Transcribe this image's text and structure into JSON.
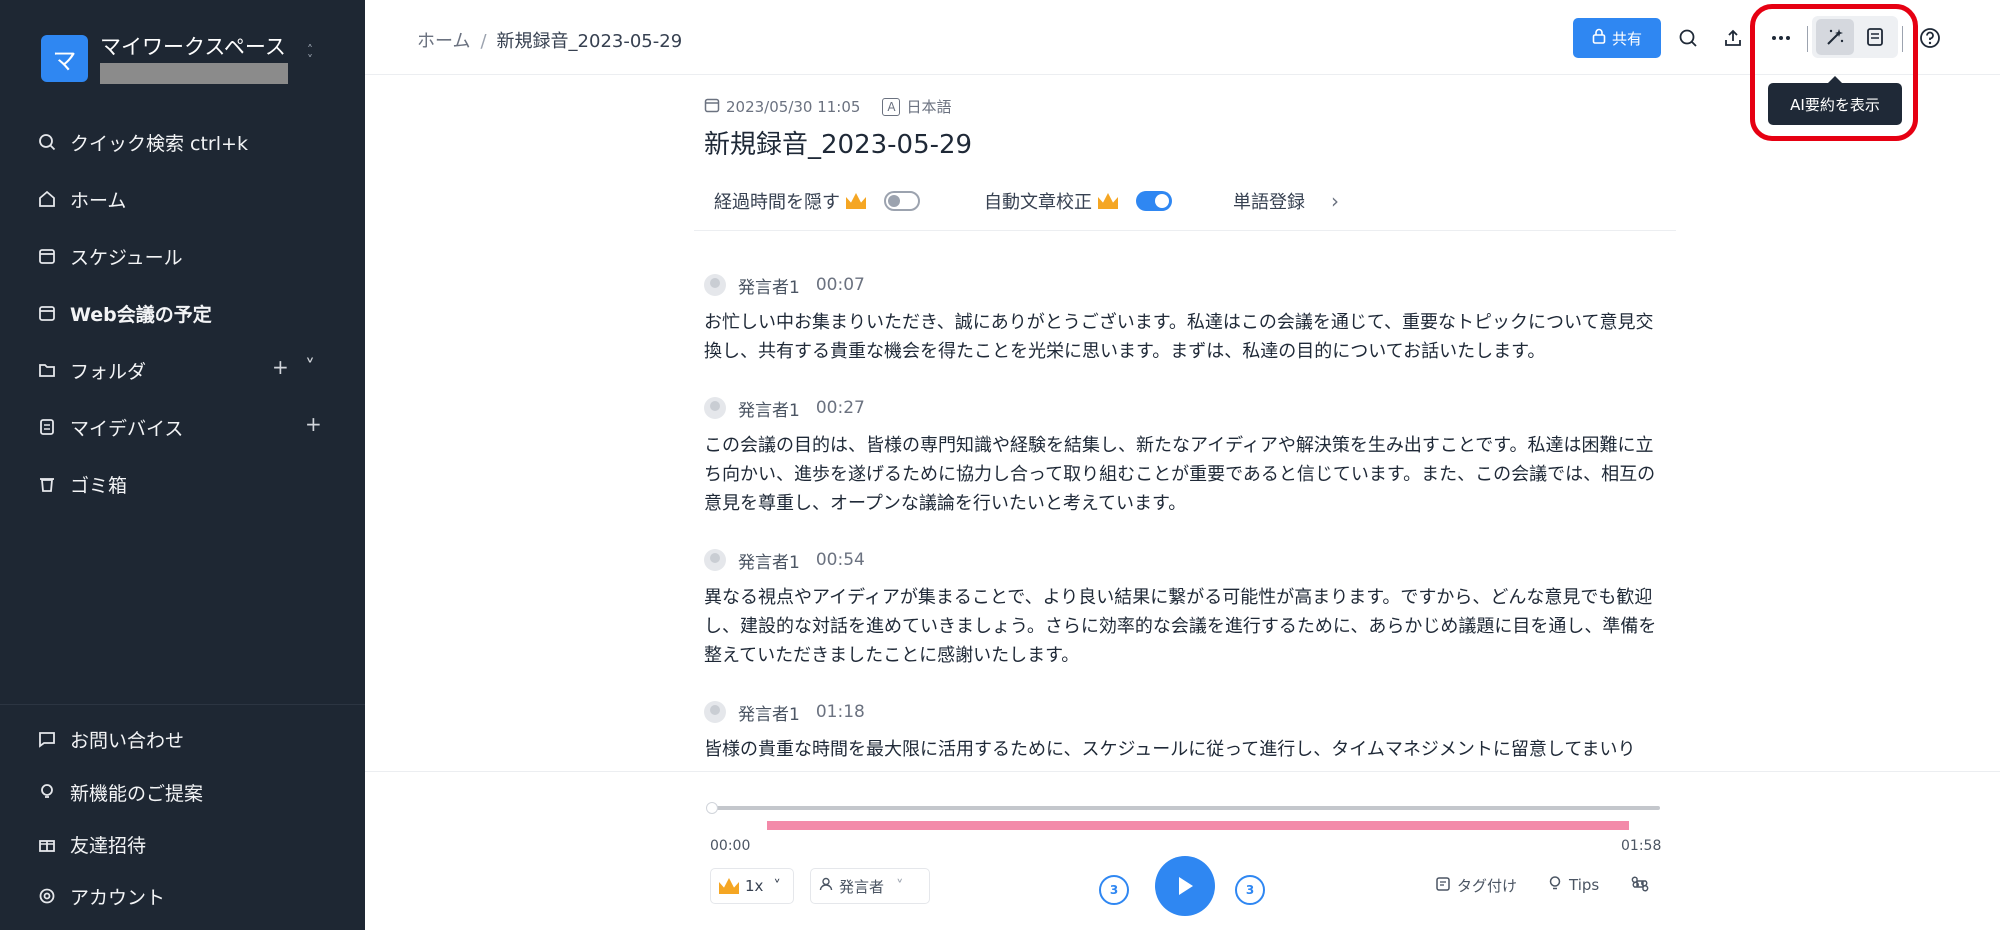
{
  "workspace": {
    "initial": "マ",
    "name": "マイワークスペース"
  },
  "sidebar": {
    "items": [
      {
        "label": "クイック検索 ctrl+k",
        "icon": "search-icon"
      },
      {
        "label": "ホーム",
        "icon": "home-icon"
      },
      {
        "label": "スケジュール",
        "icon": "calendar-icon"
      },
      {
        "label": "Web会議の予定",
        "icon": "calendar-icon"
      },
      {
        "label": "フォルダ",
        "icon": "folder-icon"
      },
      {
        "label": "マイデバイス",
        "icon": "device-icon"
      },
      {
        "label": "ゴミ箱",
        "icon": "trash-icon"
      }
    ],
    "bottom_items": [
      {
        "label": "お問い合わせ",
        "icon": "chat-icon"
      },
      {
        "label": "新機能のご提案",
        "icon": "lightbulb-icon"
      },
      {
        "label": "友達招待",
        "icon": "gift-icon"
      },
      {
        "label": "アカウント",
        "icon": "gear-icon"
      }
    ]
  },
  "header": {
    "breadcrumb_home": "ホーム",
    "breadcrumb_sep": "/",
    "breadcrumb_current": "新規録音_2023-05-29",
    "share_label": "共有",
    "tooltip": "AI要約を表示"
  },
  "recording": {
    "datetime": "2023/05/30 11:05",
    "language_icon": "A",
    "language": "日本語",
    "title": "新規録音_2023-05-29"
  },
  "options": {
    "hide_elapsed": "経過時間を隠す",
    "auto_correct": "自動文章校正",
    "word_register": "単語登録",
    "hide_elapsed_on": false,
    "auto_correct_on": true
  },
  "transcript": [
    {
      "speaker": "発言者1",
      "time": "00:07",
      "text": "お忙しい中お集まりいただき、誠にありがとうございます。私達はこの会議を通じて、重要なトピックについて意見交換し、共有する貴重な機会を得たことを光栄に思います。まずは、私達の目的についてお話いたします。"
    },
    {
      "speaker": "発言者1",
      "time": "00:27",
      "text": "この会議の目的は、皆様の専門知識や経験を結集し、新たなアイディアや解決策を生み出すことです。私達は困難に立ち向かい、進歩を遂げるために協力し合って取り組むことが重要であると信じています。また、この会議では、相互の意見を尊重し、オープンな議論を行いたいと考えています。"
    },
    {
      "speaker": "発言者1",
      "time": "00:54",
      "text": "異なる視点やアイディアが集まることで、より良い結果に繋がる可能性が高まります。ですから、どんな意見でも歓迎し、建設的な対話を進めていきましょう。さらに効率的な会議を進行するために、あらかじめ議題に目を通し、準備を整えていただきましたことに感謝いたします。"
    },
    {
      "speaker": "発言者1",
      "time": "01:18",
      "text": "皆様の貴重な時間を最大限に活用するために、スケジュールに従って進行し、タイムマネジメントに留意してまいり"
    }
  ],
  "player": {
    "time_start": "00:00",
    "time_end": "01:58",
    "position_fraction": 0,
    "speed": "1x",
    "speaker_filter": "発言者",
    "skip_back": "3",
    "skip_forward": "3",
    "tag_label": "タグ付け",
    "tips_label": "Tips"
  },
  "colors": {
    "accent": "#2f87f2",
    "sidebar_bg": "#1e2733",
    "progress_highlight": "#f38aa9",
    "highlight_ring": "#e60012"
  }
}
